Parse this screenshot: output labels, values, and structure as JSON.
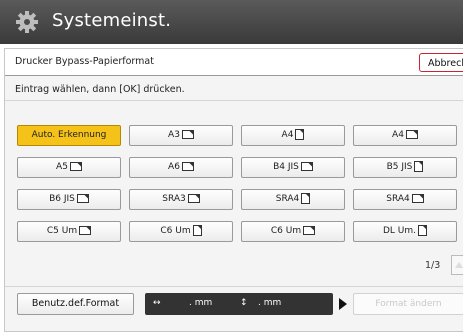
{
  "header": {
    "title": "Systemeinst."
  },
  "panel": {
    "title": "Drucker Bypass-Papierformat",
    "cancel_label": "Abbrechen",
    "instruction": "Eintrag wählen, dann [OK] drücken."
  },
  "formats": [
    {
      "label": "Auto. Erkennung",
      "selected": true,
      "icon": ""
    },
    {
      "label": "A3",
      "selected": false,
      "icon": "landscape-paper-icon"
    },
    {
      "label": "A4",
      "selected": false,
      "icon": "portrait-paper-icon"
    },
    {
      "label": "A4",
      "selected": false,
      "icon": "landscape-paper-icon"
    },
    {
      "label": "A5",
      "selected": false,
      "icon": "landscape-paper-icon"
    },
    {
      "label": "A6",
      "selected": false,
      "icon": "landscape-paper-icon"
    },
    {
      "label": "B4 JIS",
      "selected": false,
      "icon": "landscape-paper-icon"
    },
    {
      "label": "B5 JIS",
      "selected": false,
      "icon": "portrait-paper-icon"
    },
    {
      "label": "B6 JIS",
      "selected": false,
      "icon": "landscape-paper-icon"
    },
    {
      "label": "SRA3",
      "selected": false,
      "icon": "landscape-paper-icon"
    },
    {
      "label": "SRA4",
      "selected": false,
      "icon": "portrait-paper-icon"
    },
    {
      "label": "SRA4",
      "selected": false,
      "icon": "landscape-paper-icon"
    },
    {
      "label": "C5 Um",
      "selected": false,
      "icon": "landscape-paper-icon"
    },
    {
      "label": "C6 Um",
      "selected": false,
      "icon": "portrait-paper-icon"
    },
    {
      "label": "C6 Um",
      "selected": false,
      "icon": "landscape-paper-icon"
    },
    {
      "label": "DL Um.",
      "selected": false,
      "icon": "portrait-paper-icon"
    }
  ],
  "pagination": {
    "current": "1/3"
  },
  "footer": {
    "custom_label": "Benutz.def.Format",
    "horizontal_text": ". mm",
    "vertical_text": ". mm",
    "horizontal_arrow": "↔",
    "vertical_arrow": "↕",
    "change_label": "Format ändern"
  },
  "colors": {
    "selected": "#f5c21a",
    "titlebar": "#444444"
  }
}
